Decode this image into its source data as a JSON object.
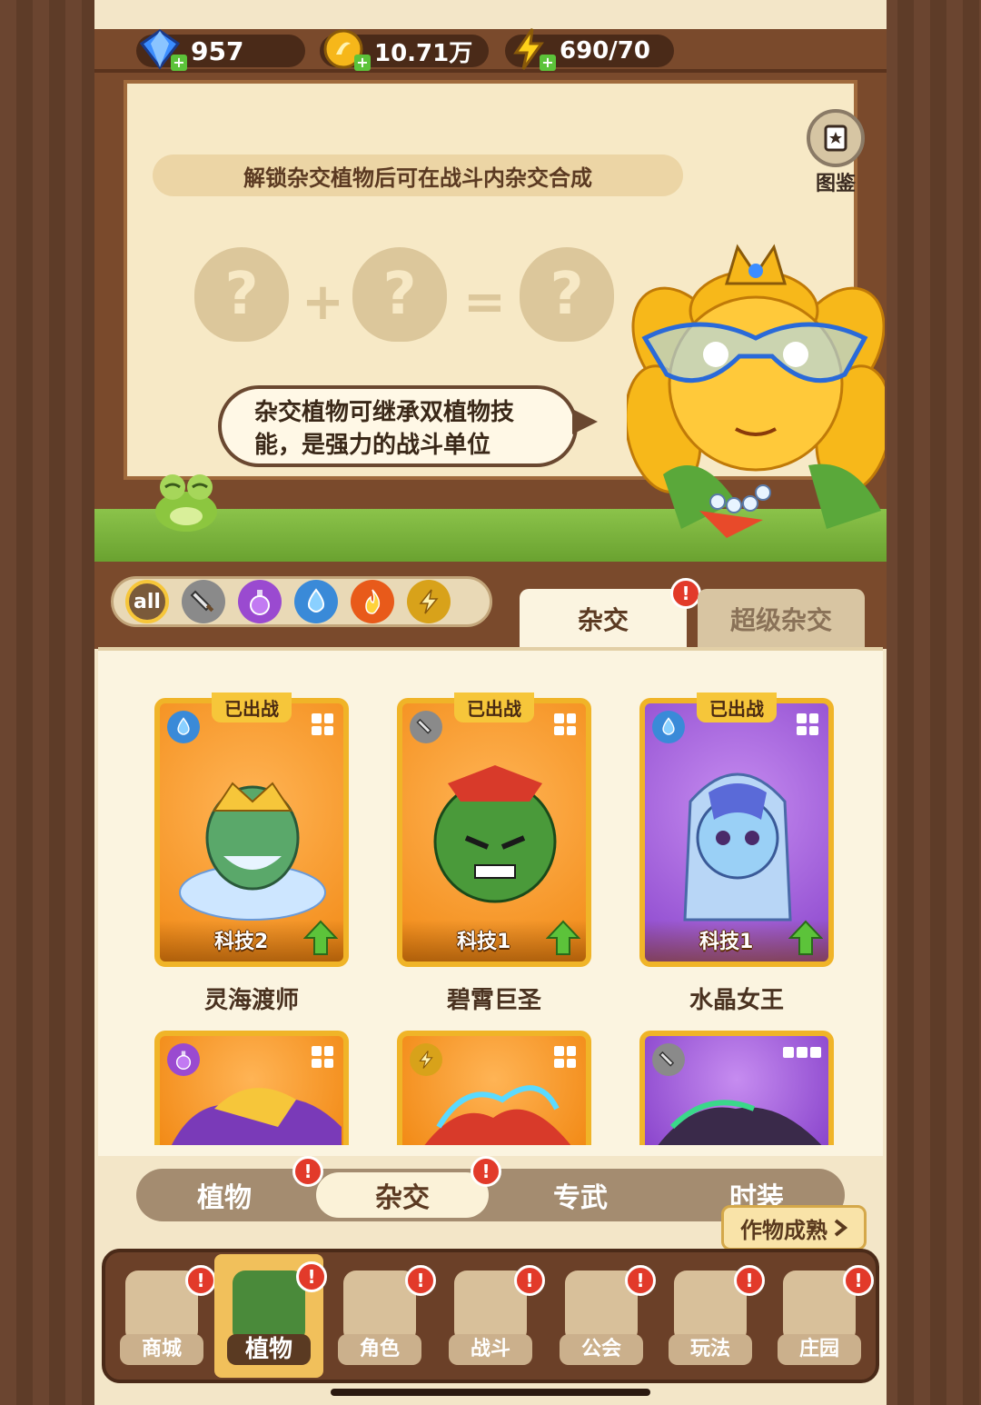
{
  "resources": {
    "gems": "957",
    "coins": "10.71万",
    "energy": "690/70"
  },
  "board": {
    "hint": "解锁杂交植物后可在战斗内杂交合成",
    "codex_label": "图鉴",
    "speech_line1": "杂交植物可继承双植物技",
    "speech_line2": "能，是强力的战斗单位",
    "mystery": "?",
    "plus": "+",
    "equals": "="
  },
  "filters": [
    {
      "name": "all",
      "label": "all",
      "color": "#7a5a3a"
    },
    {
      "name": "sword",
      "label": "",
      "color": "#8a8a8a"
    },
    {
      "name": "potion",
      "label": "",
      "color": "#9a4ad0"
    },
    {
      "name": "water",
      "label": "",
      "color": "#3a8ad8"
    },
    {
      "name": "fire",
      "label": "",
      "color": "#e85a1a"
    },
    {
      "name": "lightning",
      "label": "",
      "color": "#d8a21a"
    }
  ],
  "tabs": {
    "hybrid": "杂交",
    "super_hybrid": "超级杂交",
    "badge": "!"
  },
  "cards": [
    {
      "name": "灵海渡师",
      "deployed": "已出战",
      "tech": "科技2",
      "element": "water",
      "theme": "orange"
    },
    {
      "name": "碧霄巨圣",
      "deployed": "已出战",
      "tech": "科技1",
      "element": "sword",
      "theme": "orange"
    },
    {
      "name": "水晶女王",
      "deployed": "已出战",
      "tech": "科技1",
      "element": "water",
      "theme": "purple"
    },
    {
      "element": "potion",
      "theme": "orange"
    },
    {
      "element": "lightning",
      "theme": "orange"
    },
    {
      "element": "sword",
      "theme": "purple"
    }
  ],
  "subnav": {
    "plants": "植物",
    "hybrid": "杂交",
    "exclusive": "专武",
    "fashion": "时装"
  },
  "crop_tip": "作物成熟",
  "bottom_nav": {
    "shop": "商城",
    "plants": "植物",
    "character": "角色",
    "battle": "战斗",
    "guild": "公会",
    "gameplay": "玩法",
    "manor": "庄园"
  },
  "colors": {
    "accent_green": "#5cc33a",
    "badge_red": "#e23a2a",
    "card_border": "#f0b428"
  }
}
